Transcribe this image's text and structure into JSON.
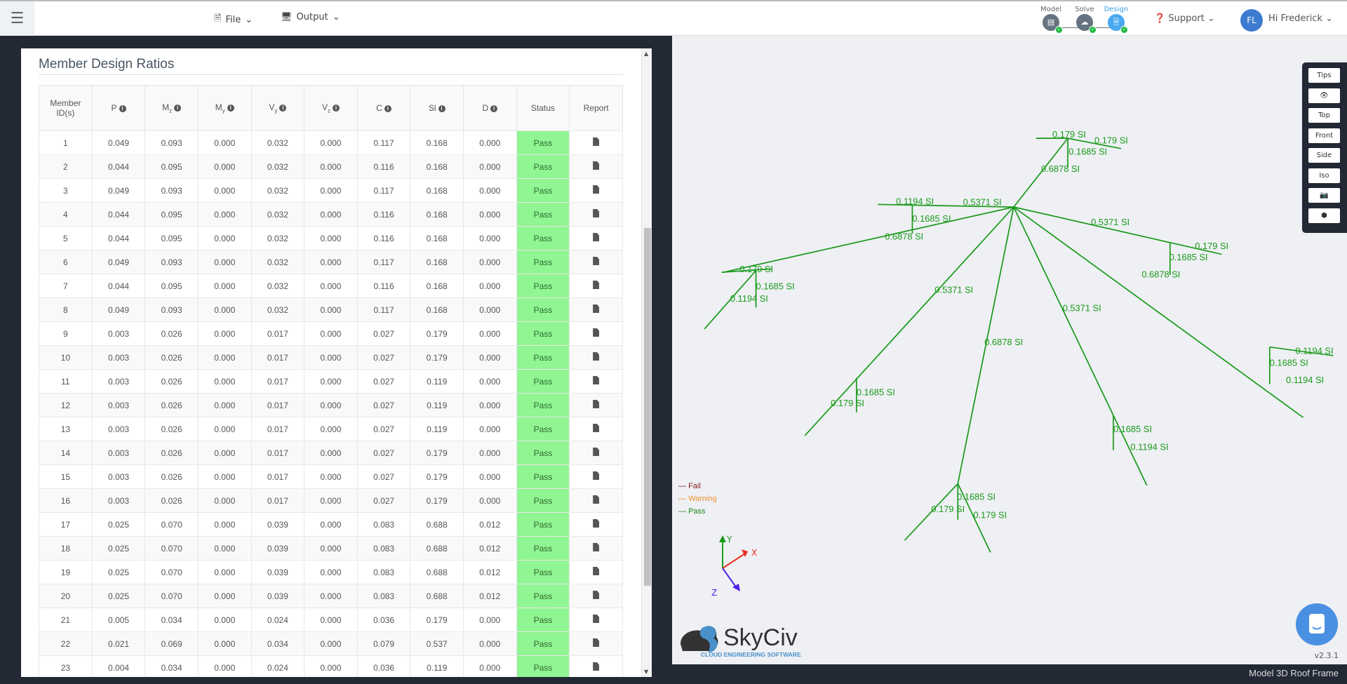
{
  "header": {
    "file": "File",
    "output": "Output",
    "steps": [
      {
        "label": "Model"
      },
      {
        "label": "Solve"
      },
      {
        "label": "Design"
      }
    ],
    "support": "Support",
    "avatar": "FL",
    "user": "Hi Frederick"
  },
  "panel": {
    "title": "Member Design Ratios",
    "columns": [
      "Member ID(s)",
      "P",
      "Mz",
      "My",
      "Vy",
      "Vz",
      "C",
      "Sl",
      "D",
      "Status",
      "Report"
    ],
    "rows": [
      [
        "1",
        "0.049",
        "0.093",
        "0.000",
        "0.032",
        "0.000",
        "0.117",
        "0.168",
        "0.000",
        "Pass"
      ],
      [
        "2",
        "0.044",
        "0.095",
        "0.000",
        "0.032",
        "0.000",
        "0.116",
        "0.168",
        "0.000",
        "Pass"
      ],
      [
        "3",
        "0.049",
        "0.093",
        "0.000",
        "0.032",
        "0.000",
        "0.117",
        "0.168",
        "0.000",
        "Pass"
      ],
      [
        "4",
        "0.044",
        "0.095",
        "0.000",
        "0.032",
        "0.000",
        "0.116",
        "0.168",
        "0.000",
        "Pass"
      ],
      [
        "5",
        "0.044",
        "0.095",
        "0.000",
        "0.032",
        "0.000",
        "0.116",
        "0.168",
        "0.000",
        "Pass"
      ],
      [
        "6",
        "0.049",
        "0.093",
        "0.000",
        "0.032",
        "0.000",
        "0.117",
        "0.168",
        "0.000",
        "Pass"
      ],
      [
        "7",
        "0.044",
        "0.095",
        "0.000",
        "0.032",
        "0.000",
        "0.116",
        "0.168",
        "0.000",
        "Pass"
      ],
      [
        "8",
        "0.049",
        "0.093",
        "0.000",
        "0.032",
        "0.000",
        "0.117",
        "0.168",
        "0.000",
        "Pass"
      ],
      [
        "9",
        "0.003",
        "0.026",
        "0.000",
        "0.017",
        "0.000",
        "0.027",
        "0.179",
        "0.000",
        "Pass"
      ],
      [
        "10",
        "0.003",
        "0.026",
        "0.000",
        "0.017",
        "0.000",
        "0.027",
        "0.179",
        "0.000",
        "Pass"
      ],
      [
        "11",
        "0.003",
        "0.026",
        "0.000",
        "0.017",
        "0.000",
        "0.027",
        "0.119",
        "0.000",
        "Pass"
      ],
      [
        "12",
        "0.003",
        "0.026",
        "0.000",
        "0.017",
        "0.000",
        "0.027",
        "0.119",
        "0.000",
        "Pass"
      ],
      [
        "13",
        "0.003",
        "0.026",
        "0.000",
        "0.017",
        "0.000",
        "0.027",
        "0.119",
        "0.000",
        "Pass"
      ],
      [
        "14",
        "0.003",
        "0.026",
        "0.000",
        "0.017",
        "0.000",
        "0.027",
        "0.179",
        "0.000",
        "Pass"
      ],
      [
        "15",
        "0.003",
        "0.026",
        "0.000",
        "0.017",
        "0.000",
        "0.027",
        "0.179",
        "0.000",
        "Pass"
      ],
      [
        "16",
        "0.003",
        "0.026",
        "0.000",
        "0.017",
        "0.000",
        "0.027",
        "0.179",
        "0.000",
        "Pass"
      ],
      [
        "17",
        "0.025",
        "0.070",
        "0.000",
        "0.039",
        "0.000",
        "0.083",
        "0.688",
        "0.012",
        "Pass"
      ],
      [
        "18",
        "0.025",
        "0.070",
        "0.000",
        "0.039",
        "0.000",
        "0.083",
        "0.688",
        "0.012",
        "Pass"
      ],
      [
        "19",
        "0.025",
        "0.070",
        "0.000",
        "0.039",
        "0.000",
        "0.083",
        "0.688",
        "0.012",
        "Pass"
      ],
      [
        "20",
        "0.025",
        "0.070",
        "0.000",
        "0.039",
        "0.000",
        "0.083",
        "0.688",
        "0.012",
        "Pass"
      ],
      [
        "21",
        "0.005",
        "0.034",
        "0.000",
        "0.024",
        "0.000",
        "0.036",
        "0.179",
        "0.000",
        "Pass"
      ],
      [
        "22",
        "0.021",
        "0.069",
        "0.000",
        "0.034",
        "0.000",
        "0.079",
        "0.537",
        "0.000",
        "Pass"
      ],
      [
        "23",
        "0.004",
        "0.034",
        "0.000",
        "0.024",
        "0.000",
        "0.036",
        "0.119",
        "0.000",
        "Pass"
      ]
    ]
  },
  "viewer": {
    "tools": [
      "Tips",
      "eye-icon",
      "Top",
      "Front",
      "Side",
      "Iso",
      "camera-icon",
      "cube-icon"
    ],
    "labels": [
      "0.179 SI",
      "0.179 SI",
      "0.1685 SI",
      "0.6878 SI",
      "0.1194 SI",
      "0.5371 SI",
      "0.1685 SI",
      "0.6878 SI",
      "0.179 SI",
      "0.1685 SI",
      "0.1194 SI",
      "0.5371 SI",
      "0.1685 SI",
      "0.179 SI",
      "0.6878 SI",
      "0.1685 SI",
      "0.179 SI",
      "0.179 SI",
      "0.5371 SI",
      "0.1685 SI",
      "0.1194 SI",
      "0.5371 SI",
      "0.179 SI",
      "0.1685 SI",
      "0.6878 SI",
      "0.1194 SI",
      "0.1685 SI",
      "0.1194 SI"
    ],
    "legend": [
      {
        "label": "Fail",
        "color": "#8b1a1a"
      },
      {
        "label": "Warning",
        "color": "#f0932b"
      },
      {
        "label": "Pass",
        "color": "#1a8a1a"
      }
    ],
    "member_color": "#1a9a1a",
    "axes": {
      "x": "X",
      "y": "Y",
      "z": "Z"
    },
    "logo": {
      "name": "SkyCiv",
      "tagline": "CLOUD ENGINEERING SOFTWARE"
    },
    "version": "v2.3.1"
  },
  "footer": {
    "model_name": "Model 3D Roof Frame"
  }
}
